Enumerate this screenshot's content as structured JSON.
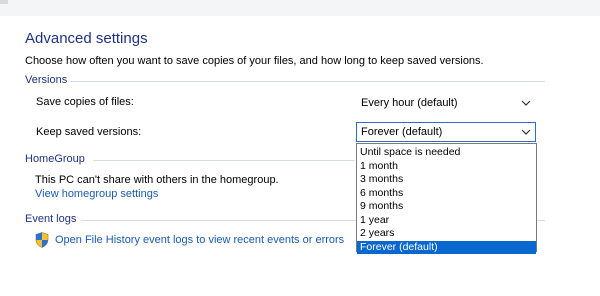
{
  "header": {
    "title": "Advanced settings",
    "description": "Choose how often you want to save copies of your files, and how long to keep saved versions."
  },
  "versions": {
    "heading": "Versions",
    "save_copies": {
      "label": "Save copies of files:",
      "value": "Every hour (default)"
    },
    "keep_versions": {
      "label": "Keep saved versions:",
      "value": "Forever (default)",
      "options": [
        "Until space is needed",
        "1 month",
        "3 months",
        "6 months",
        "9 months",
        "1 year",
        "2 years",
        "Forever (default)"
      ],
      "selected_index": 7
    }
  },
  "homegroup": {
    "heading": "HomeGroup",
    "message": "This PC can't share with others in the homegroup.",
    "link": "View homegroup settings"
  },
  "event_logs": {
    "heading": "Event logs",
    "link": "Open File History event logs to view recent events or errors",
    "icon": "shield-icon"
  },
  "colors": {
    "heading": "#1e3287",
    "link": "#1a5bb4",
    "selection": "#0a67cf"
  }
}
